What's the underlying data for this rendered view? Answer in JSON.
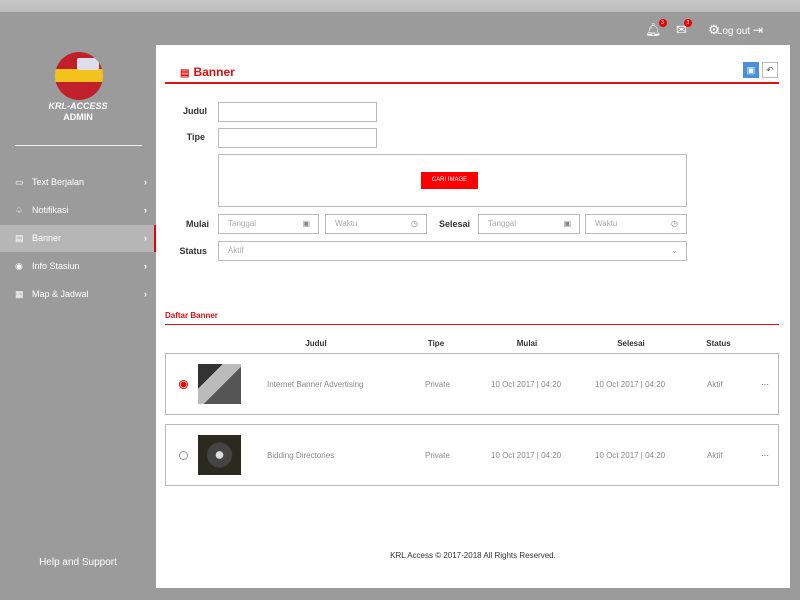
{
  "header": {
    "notification_badge": "3",
    "mail_badge": "3",
    "logout_label": "Log out"
  },
  "sidebar": {
    "brand": "KRL-ACCESS",
    "role": "ADMIN",
    "items": [
      {
        "label": "Text Berjalan",
        "icon": "message-icon"
      },
      {
        "label": "Notifikasi",
        "icon": "bell-icon"
      },
      {
        "label": "Banner",
        "icon": "banner-icon",
        "active": true
      },
      {
        "label": "Info Stasiun",
        "icon": "location-pin-icon"
      },
      {
        "label": "Map & Jadwal",
        "icon": "map-icon"
      }
    ],
    "help": "Help and Support"
  },
  "form": {
    "title": "Banner",
    "judul_label": "Judul",
    "tipe_label": "Tipe",
    "cari_image": "CARI IMAGE",
    "mulai_label": "Mulai",
    "selesai_label": "Selesai",
    "status_label": "Status",
    "tanggal_placeholder": "Tanggal",
    "waktu_placeholder": "Waktu",
    "status_value": "Aktif"
  },
  "list": {
    "title": "Daftar Banner",
    "columns": [
      "Judul",
      "Tipe",
      "Mulai",
      "Selesai",
      "Status"
    ],
    "rows": [
      {
        "judul": "Internet Banner Advertising",
        "tipe": "Private",
        "mulai": "10 Oct 2017 | 04:20",
        "selesai": "10 Oct 2017 | 04:20",
        "status": "Aktif",
        "selected": true
      },
      {
        "judul": "Bidding Directories",
        "tipe": "Private",
        "mulai": "10 Oct 2017 | 04:20",
        "selesai": "10 Oct 2017 | 04:20",
        "status": "Aktif",
        "selected": false
      }
    ]
  },
  "footer": "KRL Access © 2017-2018 All Rights Reserved.",
  "colors": {
    "accent": "#e01010",
    "save": "#4a90d9"
  }
}
